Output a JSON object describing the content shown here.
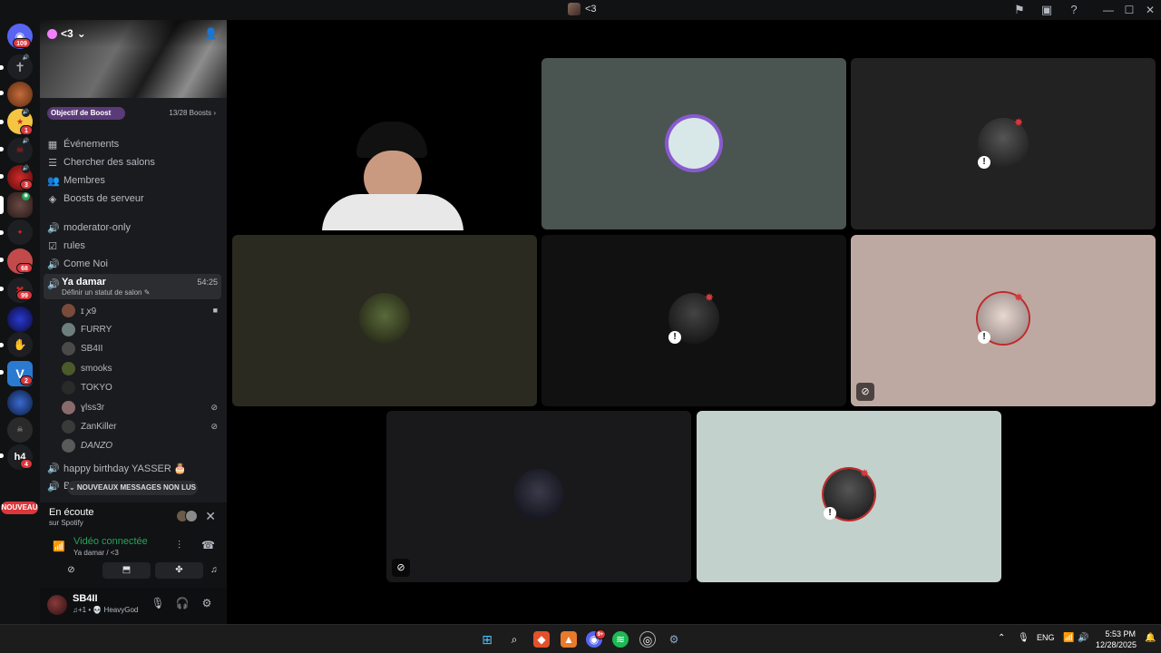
{
  "titlebar": {
    "title": "<3",
    "icons": [
      "inbox-icon",
      "window-icon",
      "help-icon"
    ],
    "window_controls": [
      "minimize",
      "maximize",
      "close"
    ]
  },
  "rail": {
    "home_badge": "109",
    "badges": [
      "1",
      "3",
      "68",
      "99",
      "2",
      "4"
    ],
    "nouveau_label": "NOUVEAU"
  },
  "server": {
    "name": "<3",
    "boost_goal_label": "Objectif de Boost",
    "boost_count": "13/28 Boosts"
  },
  "menu": [
    {
      "icon": "calendar-icon",
      "label": "Événements"
    },
    {
      "icon": "browse-channels-icon",
      "label": "Chercher des salons"
    },
    {
      "icon": "members-icon",
      "label": "Membres"
    },
    {
      "icon": "boost-icon",
      "label": "Boosts de serveur"
    }
  ],
  "channels": [
    {
      "icon": "voice-icon",
      "label": "moderator-only"
    },
    {
      "icon": "rules-icon",
      "label": "rules"
    },
    {
      "icon": "voice-icon",
      "label": "Come Noi"
    }
  ],
  "active_voice": {
    "name": "Ya damar",
    "status": "Définir un statut de salon",
    "timer": "54:25"
  },
  "voice_users": [
    {
      "name": "ɪ ꭗ9",
      "color": "#7a4a3a",
      "icon": "video-icon"
    },
    {
      "name": "FURRY",
      "color": "#6d7f7a",
      "icon": ""
    },
    {
      "name": "SB4II",
      "color": "#4a4a4a",
      "icon": ""
    },
    {
      "name": "smooks",
      "color": "#4b5a2a",
      "icon": ""
    },
    {
      "name": "TOKYO",
      "color": "#2a2a2a",
      "icon": ""
    },
    {
      "name": "ɣlss3r",
      "color": "#8a6a6a",
      "icon": "deafened-icon"
    },
    {
      "name": "ZanKiller",
      "color": "#3a3a3a",
      "icon": "deafened-icon"
    },
    {
      "name": "DANZO",
      "color": "#5a5a5a",
      "icon": ""
    }
  ],
  "after_channels": [
    {
      "icon": "voice-icon",
      "label": "happy birthday YASSER 🎂"
    },
    {
      "icon": "voice-icon",
      "label": "B"
    }
  ],
  "new_messages_label": "NOUVEAUX MESSAGES NON LUS",
  "listening": {
    "title": "En écoute",
    "subtitle": "sur Spotify"
  },
  "voice_connection": {
    "status": "Vidéo connectée",
    "location": "Ya damar / <3"
  },
  "voice_buttons": [
    "camera-off-icon",
    "screen-share-icon",
    "activities-icon",
    "soundboard-icon"
  ],
  "user": {
    "name": "SB4II",
    "status": "♫+1 • 💀 HeavyGod"
  },
  "tiles": [
    {
      "name": "tile-camera-user",
      "bg": "#000000",
      "avatar_color": ""
    },
    {
      "name": "tile-user-2",
      "bg": "#4a5552",
      "avatar_color": "#8a5ad0"
    },
    {
      "name": "tile-user-3",
      "bg": "#222222",
      "avatar_color": "#3a2a2a"
    },
    {
      "name": "tile-user-4",
      "bg": "#2a2a20",
      "avatar_color": "#3d4a2a"
    },
    {
      "name": "tile-user-5",
      "bg": "#111111",
      "avatar_color": "#2a2a2a"
    },
    {
      "name": "tile-user-6",
      "bg": "#bea9a2",
      "avatar_color": "#c8b8b8"
    },
    {
      "name": "tile-user-7",
      "bg": "#19181a",
      "avatar_color": "#2a2a3a"
    },
    {
      "name": "tile-user-8",
      "bg": "#c3d1cc",
      "avatar_color": "#2a2a2a"
    }
  ],
  "taskbar": {
    "apps": [
      "windows-icon",
      "search-icon",
      "brave-icon",
      "app-icon",
      "discord-icon",
      "spotify-icon",
      "chrome-icon",
      "steam-icon"
    ],
    "discord_badge": "9+",
    "lang": "ENG",
    "time": "5:53 PM",
    "date": "12/28/2025"
  }
}
